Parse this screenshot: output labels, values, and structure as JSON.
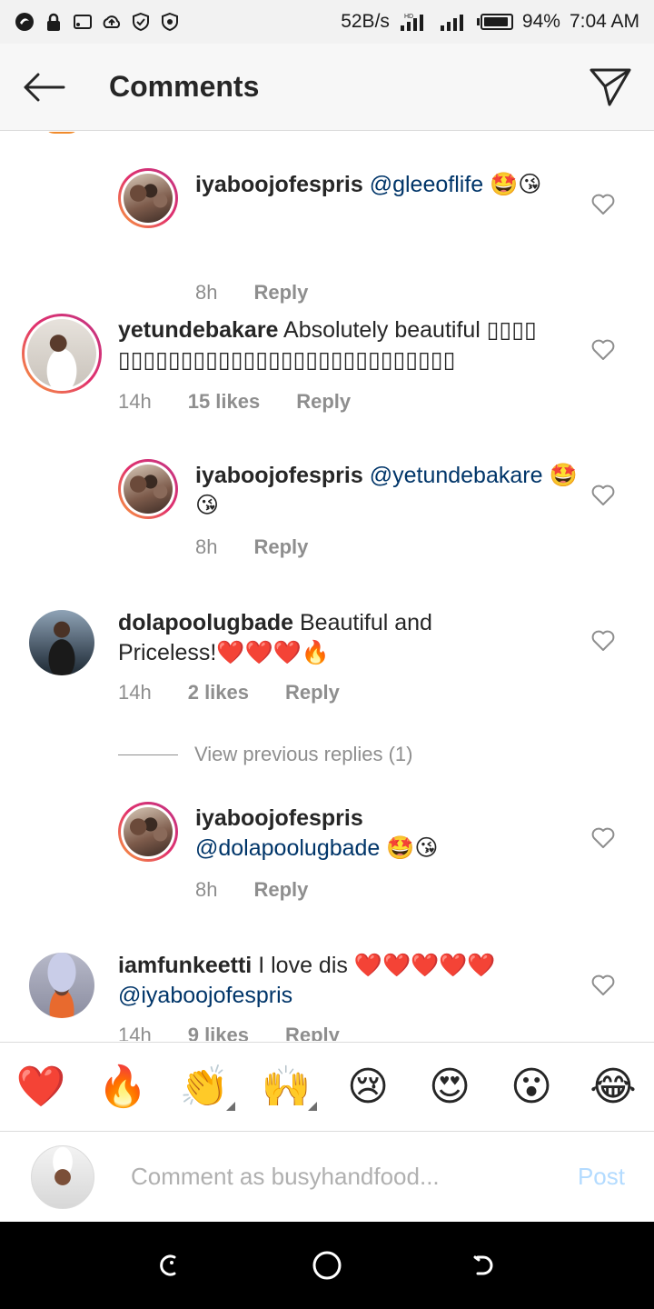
{
  "status_bar": {
    "net_speed": "52B/s",
    "battery": "94%",
    "battery_level": 0.94,
    "time": "7:04 AM"
  },
  "header": {
    "title": "Comments",
    "back_icon": "arrow-left-icon",
    "share_icon": "send-icon"
  },
  "comments": [
    {
      "user": "iyaboojofespris",
      "mention": "@gleeoflife",
      "text": "",
      "emojis": "🤩😘",
      "time": "8h",
      "likes": "",
      "reply": "Reply",
      "is_reply": true
    },
    {
      "user": "yetundebakare",
      "mention": "",
      "text": "Absolutely beautiful ▯▯▯▯ ▯▯▯▯▯▯▯▯▯▯▯▯▯▯▯▯▯▯▯▯▯▯▯▯▯▯▯",
      "emojis": "",
      "time": "14h",
      "likes": "15 likes",
      "reply": "Reply",
      "is_reply": false
    },
    {
      "user": "iyaboojofespris",
      "mention": "@yetundebakare",
      "text": "",
      "emojis": "🤩😘",
      "time": "8h",
      "likes": "",
      "reply": "Reply",
      "is_reply": true
    },
    {
      "user": "dolapoolugbade",
      "mention": "",
      "text": "Beautiful and Priceless!",
      "emojis": "❤️❤️❤️🔥",
      "time": "14h",
      "likes": "2 likes",
      "reply": "Reply",
      "is_reply": false
    },
    {
      "user": "iyaboojofespris",
      "mention": "@dolapoolugbade",
      "text": "",
      "emojis": "🤩😘",
      "time": "8h",
      "likes": "",
      "reply": "Reply",
      "is_reply": true
    },
    {
      "user": "iamfunkeetti",
      "mention": "@iyaboojofespris",
      "text": "I love dis",
      "emojis": "❤️❤️❤️❤️❤️",
      "time": "14h",
      "likes": "9 likes",
      "reply": "Reply",
      "is_reply": false
    }
  ],
  "view_previous": "View previous replies (1)",
  "emoji_bar": [
    "❤️",
    "🔥",
    "👏",
    "🙌",
    "😢",
    "😍",
    "😮",
    "😂"
  ],
  "input": {
    "placeholder": "Comment as busyhandfood...",
    "post_label": "Post"
  },
  "colors": {
    "mention": "#003569",
    "meta": "#8e8e8e",
    "post_disabled": "#b3dbff"
  }
}
